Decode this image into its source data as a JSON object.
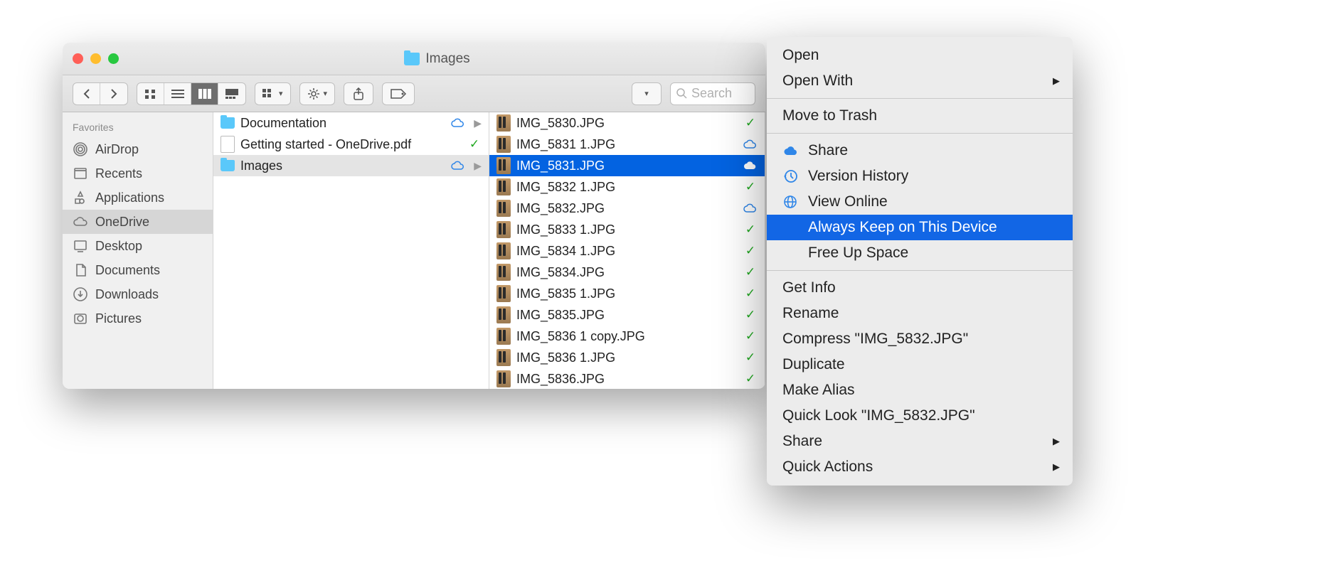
{
  "window": {
    "title": "Images"
  },
  "search": {
    "placeholder": "Search"
  },
  "sidebar": {
    "header": "Favorites",
    "items": [
      {
        "label": "AirDrop",
        "icon": "airdrop"
      },
      {
        "label": "Recents",
        "icon": "recents"
      },
      {
        "label": "Applications",
        "icon": "applications"
      },
      {
        "label": "OneDrive",
        "icon": "cloud",
        "selected": true
      },
      {
        "label": "Desktop",
        "icon": "desktop"
      },
      {
        "label": "Documents",
        "icon": "documents"
      },
      {
        "label": "Downloads",
        "icon": "downloads"
      },
      {
        "label": "Pictures",
        "icon": "pictures"
      }
    ]
  },
  "column1": [
    {
      "label": "Documentation",
      "icon": "folder",
      "status": "cloud",
      "expandable": true
    },
    {
      "label": "Getting started - OneDrive.pdf",
      "icon": "doc",
      "status": "synced"
    },
    {
      "label": "Images",
      "icon": "folder",
      "status": "cloud",
      "expandable": true,
      "selected": true
    }
  ],
  "column2": [
    {
      "label": "IMG_5830.JPG",
      "status": "synced"
    },
    {
      "label": "IMG_5831 1.JPG",
      "status": "cloud"
    },
    {
      "label": "IMG_5831.JPG",
      "status": "cloud-white",
      "selected": true
    },
    {
      "label": "IMG_5832 1.JPG",
      "status": "synced"
    },
    {
      "label": "IMG_5832.JPG",
      "status": "cloud"
    },
    {
      "label": "IMG_5833 1.JPG",
      "status": "synced"
    },
    {
      "label": "IMG_5834 1.JPG",
      "status": "synced"
    },
    {
      "label": "IMG_5834.JPG",
      "status": "synced"
    },
    {
      "label": "IMG_5835 1.JPG",
      "status": "synced"
    },
    {
      "label": "IMG_5835.JPG",
      "status": "synced"
    },
    {
      "label": "IMG_5836 1 copy.JPG",
      "status": "synced"
    },
    {
      "label": "IMG_5836 1.JPG",
      "status": "synced"
    },
    {
      "label": "IMG_5836.JPG",
      "status": "synced"
    }
  ],
  "context": {
    "groups": [
      [
        {
          "label": "Open"
        },
        {
          "label": "Open With",
          "submenu": true
        }
      ],
      [
        {
          "label": "Move to Trash"
        }
      ],
      [
        {
          "label": "Share",
          "icon": "cloud-blue"
        },
        {
          "label": "Version History",
          "icon": "history"
        },
        {
          "label": "View Online",
          "icon": "globe"
        },
        {
          "label": "Always Keep on This Device",
          "highlighted": true
        },
        {
          "label": "Free Up Space"
        }
      ],
      [
        {
          "label": "Get Info"
        },
        {
          "label": "Rename"
        },
        {
          "label": "Compress \"IMG_5832.JPG\""
        },
        {
          "label": "Duplicate"
        },
        {
          "label": "Make Alias"
        },
        {
          "label": "Quick Look \"IMG_5832.JPG\""
        },
        {
          "label": "Share",
          "submenu": true
        },
        {
          "label": "Quick Actions",
          "submenu": true
        }
      ]
    ]
  }
}
